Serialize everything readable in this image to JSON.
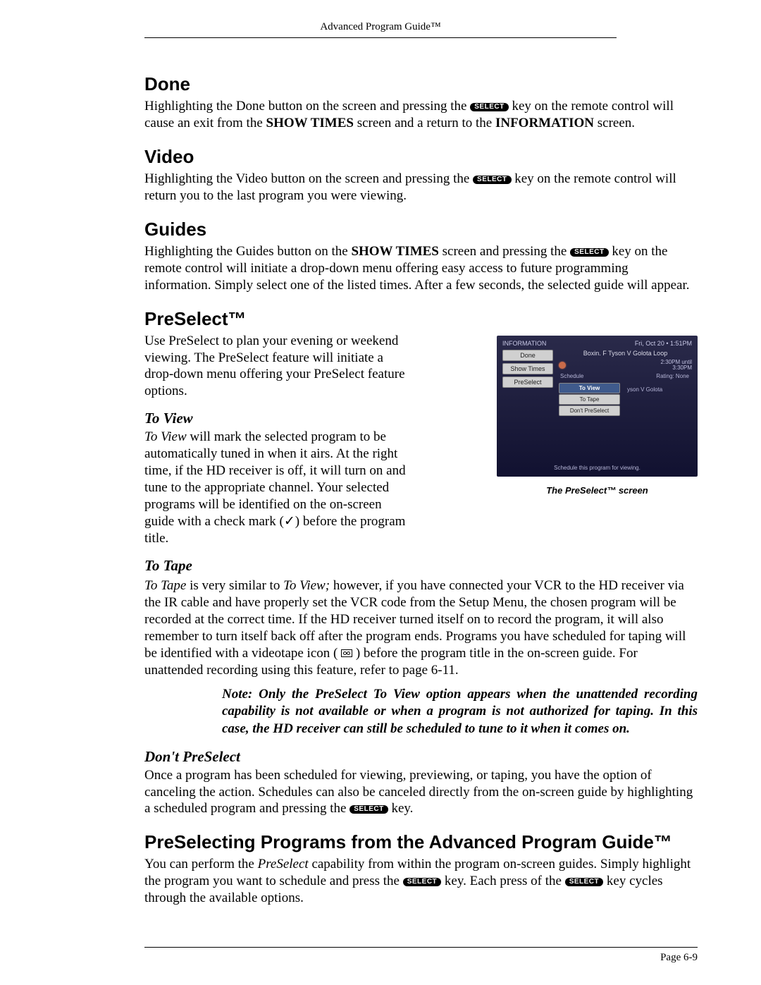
{
  "runningHeader": "Advanced Program Guide™",
  "select_label": "SELECT",
  "sections": {
    "done": {
      "heading": "Done",
      "p1a": "Highlighting the Done button on the screen and pressing the ",
      "p1b": " key on the remote control will cause an exit from the ",
      "bold1": "SHOW TIMES",
      "p1c": " screen and a return to the ",
      "bold2": "INFORMATION",
      "p1d": " screen."
    },
    "video": {
      "heading": "Video",
      "p1a": "Highlighting the Video button on the screen and pressing the ",
      "p1b": " key on the remote control will return you to the last program you were viewing."
    },
    "guides": {
      "heading": "Guides",
      "p1a": "Highlighting the Guides button on the ",
      "bold1": "SHOW TIMES",
      "p1b": " screen and pressing the ",
      "p1c": " key on the remote control will initiate a drop-down menu offering easy access to future programming information. Simply select one of the listed times. After a few seconds, the selected guide will appear."
    },
    "preselect": {
      "heading": "PreSelect™",
      "intro": "Use PreSelect to plan your evening or weekend viewing. The PreSelect feature will initiate a drop-down menu offering your PreSelect feature options.",
      "toview": {
        "heading": "To View",
        "em": "To View",
        "text": " will mark the selected program to be automatically tuned in when it airs. At the right time, if the HD receiver is off, it will turn on and tune to the appropriate channel. Your selected programs will be identified on the on-screen guide with a check mark (✓) before the program title."
      },
      "totape": {
        "heading": "To Tape",
        "em1": "To Tape",
        "t1": " is very similar to ",
        "em2": "To View;",
        "t2": " however, if you have connected your VCR to the HD receiver via the IR cable and have properly set the VCR code from the Setup Menu, the chosen program will be recorded at the correct time. If the HD receiver turned itself on to record the program, it will also remember to turn itself back off after the program ends. Programs you have scheduled for taping will be identified with a videotape icon ( ",
        "t3": " ) before the program title in the on-screen guide. For unattended recording using this feature, refer to page 6-11."
      },
      "note": "Note: Only the PreSelect To View option appears when the unattended recording capability is not available or when a program is not authorized for taping. In this case, the HD receiver can still be scheduled to tune to it when it comes on.",
      "dont": {
        "heading": "Don't PreSelect",
        "t1": "Once a program has been scheduled for viewing, previewing, or taping, you have the option of canceling the action. Schedules can also be canceled directly from the on-screen guide by highlighting a scheduled program and pressing the ",
        "t2": " key."
      }
    },
    "preselecting": {
      "heading": "PreSelecting Programs from the Advanced Program Guide™",
      "t1": "You can perform the ",
      "em1": "PreSelect",
      "t2": " capability from within the program on-screen guides. Simply highlight the program you want to schedule and press the ",
      "t3": " key. Each press of the ",
      "t4": " key cycles through the available options."
    }
  },
  "figure": {
    "caption": "The PreSelect™ screen",
    "topLeft": "INFORMATION",
    "topRight": "Fri, Oct 20 • 1:51PM",
    "buttons": [
      "Done",
      "Show Times",
      "PreSelect"
    ],
    "progTitle": "Boxin. F Tyson V Golota Loop",
    "time1": "2:30PM until",
    "time2": "3:30PM",
    "sub1": "Schedule",
    "sub2": "Rating: None",
    "opts": [
      "To View",
      "To Tape",
      "Don't PreSelect"
    ],
    "listing": "yson V Golota",
    "foot": "Schedule this program for viewing."
  },
  "pageNumber": "Page 6-9"
}
